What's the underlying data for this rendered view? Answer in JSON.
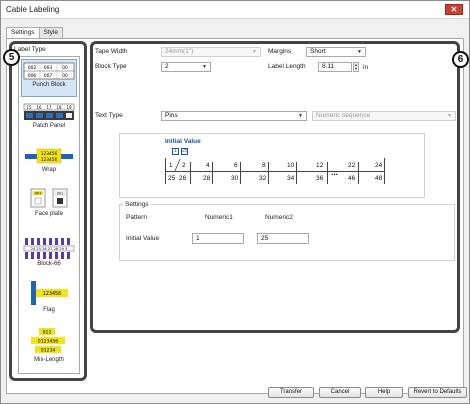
{
  "window": {
    "title": "Cable Labeling",
    "close_glyph": "✕"
  },
  "tabs": [
    {
      "label": "Settings",
      "active": true
    },
    {
      "label": "Style",
      "active": false
    }
  ],
  "left_panel": {
    "badge": "5",
    "header": "Label Type",
    "items": [
      {
        "label": "Punch Block",
        "selected": true,
        "icon": "punch-block-icon"
      },
      {
        "label": "Patch Panel",
        "selected": false,
        "icon": "patch-panel-icon"
      },
      {
        "label": "Wrap",
        "selected": false,
        "icon": "wrap-icon"
      },
      {
        "label": "Face plate",
        "selected": false,
        "icon": "face-plate-icon"
      },
      {
        "label": "Block-66",
        "selected": false,
        "icon": "block-66-icon"
      },
      {
        "label": "Flag",
        "selected": false,
        "icon": "flag-icon"
      },
      {
        "label": "Mix-Length",
        "selected": false,
        "icon": "mix-length-icon"
      }
    ],
    "icon_text": {
      "punch_block_top": [
        "002",
        "003",
        "00"
      ],
      "punch_block_bottom": [
        "006",
        "007",
        "00"
      ],
      "patch_panel": [
        "15",
        "16",
        "17",
        "18",
        "19"
      ],
      "wrap": [
        "123456",
        "123456"
      ],
      "face_plate": [
        "001",
        "001"
      ],
      "block66": "24 25 26 27 28 29 3",
      "flag": "123456",
      "mix_length": [
        "012",
        "0123456",
        "01234"
      ]
    }
  },
  "right_panel": {
    "badge": "6",
    "tape_width": {
      "label": "Tape Width",
      "value": "24mm(1\")",
      "disabled": true
    },
    "margins": {
      "label": "Margins",
      "value": "Short"
    },
    "block_type": {
      "label": "Block Type",
      "value": "2"
    },
    "label_length": {
      "label": "Label Length",
      "value": "8.11",
      "unit": "in"
    },
    "text_type": {
      "label": "Text Type",
      "value": "Pins",
      "secondary": "Numeric sequence"
    },
    "preview": {
      "title": "Initial Value",
      "boxes": [
        "1",
        "25"
      ],
      "top_numbers": [
        "1",
        "2",
        "4",
        "6",
        "8",
        "10",
        "12",
        "22",
        "24"
      ],
      "bottom_numbers": [
        "25",
        "26",
        "28",
        "30",
        "32",
        "34",
        "36",
        "46",
        "48"
      ],
      "ellipsis": "..."
    },
    "settings": {
      "legend": "Settings",
      "pattern_label": "Pattern",
      "col1": "Numeric1",
      "col2": "Numeric2",
      "initial_label": "Initial Value",
      "initial1": "1",
      "initial2": "25"
    }
  },
  "buttons": {
    "transfer": "Transfer",
    "cancel": "Cancel",
    "help": "Help",
    "revert": "Revert to Defaults"
  }
}
